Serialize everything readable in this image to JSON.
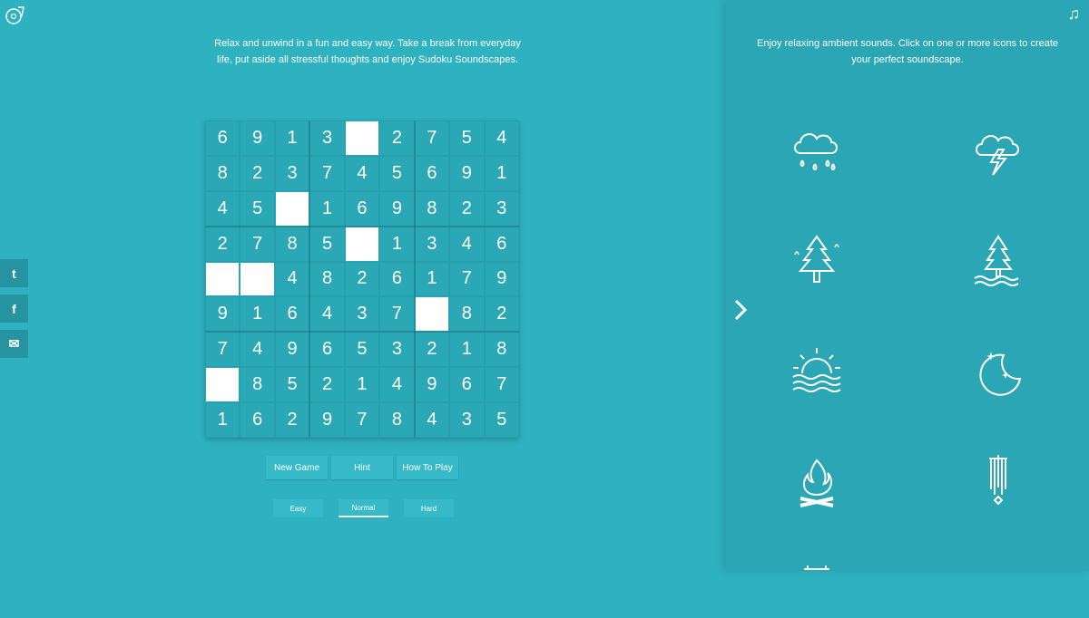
{
  "intro_text": "Relax and unwind in a fun and easy way. Take a break from everyday life, put aside all stressful thoughts and enjoy Sudoku Soundscapes.",
  "sound_panel_text": "Enjoy relaxing ambient sounds. Click on one or more icons to create your perfect soundscape.",
  "board": [
    [
      "6",
      "9",
      "1",
      "3",
      "",
      "2",
      "7",
      "5",
      "4"
    ],
    [
      "8",
      "2",
      "3",
      "7",
      "4",
      "5",
      "6",
      "9",
      "1"
    ],
    [
      "4",
      "5",
      "",
      "1",
      "6",
      "9",
      "8",
      "2",
      "3"
    ],
    [
      "2",
      "7",
      "8",
      "5",
      "",
      "1",
      "3",
      "4",
      "6"
    ],
    [
      "",
      "",
      "4",
      "8",
      "2",
      "6",
      "1",
      "7",
      "9"
    ],
    [
      "9",
      "1",
      "6",
      "4",
      "3",
      "7",
      "",
      "8",
      "2"
    ],
    [
      "7",
      "4",
      "9",
      "6",
      "5",
      "3",
      "2",
      "1",
      "8"
    ],
    [
      "",
      "8",
      "5",
      "2",
      "1",
      "4",
      "9",
      "6",
      "7"
    ],
    [
      "1",
      "6",
      "2",
      "9",
      "7",
      "8",
      "4",
      "3",
      "5"
    ]
  ],
  "actions": [
    "New Game",
    "Hint",
    "How To Play"
  ],
  "levels": [
    "Easy",
    "Normal",
    "Hard"
  ],
  "selected_level": "Normal",
  "social": [
    {
      "name": "twitter-icon",
      "glyph": "t"
    },
    {
      "name": "facebook-icon",
      "glyph": "f"
    },
    {
      "name": "email-icon",
      "glyph": "✉"
    }
  ],
  "sounds": [
    "rain-icon",
    "thunderstorm-icon",
    "forest-birds-icon",
    "lake-forest-icon",
    "ocean-sunset-icon",
    "night-moon-icon",
    "campfire-icon",
    "wind-chimes-icon"
  ],
  "music_note_glyph": "♫"
}
